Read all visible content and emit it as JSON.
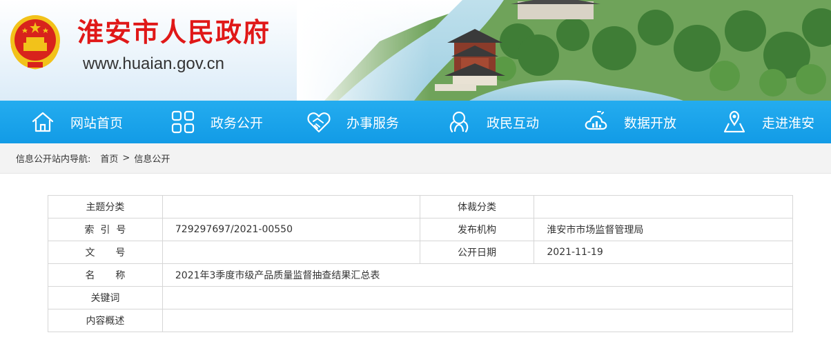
{
  "header": {
    "site_title": "淮安市人民政府",
    "site_url": "www.huaian.gov.cn",
    "brand_color": "#e01818"
  },
  "nav": {
    "items": [
      {
        "label": "网站首页",
        "icon": "home-icon"
      },
      {
        "label": "政务公开",
        "icon": "grid-icon"
      },
      {
        "label": "办事服务",
        "icon": "handshake-icon"
      },
      {
        "label": "政民互动",
        "icon": "interaction-icon"
      },
      {
        "label": "数据开放",
        "icon": "data-cloud-icon"
      },
      {
        "label": "走进淮安",
        "icon": "map-pin-icon"
      }
    ],
    "bg_color": "#1ba3ea"
  },
  "breadcrumb": {
    "label": "信息公开站内导航:",
    "items": [
      "首页",
      "信息公开"
    ],
    "separator": ">"
  },
  "info": {
    "rows": {
      "topic_label": "主题分类",
      "topic_value": "",
      "genre_label": "体裁分类",
      "genre_value": "",
      "index_label": "索引号",
      "index_value": "729297697/2021-00550",
      "publisher_label": "发布机构",
      "publisher_value": "淮安市市场监督管理局",
      "doc_no_label": "文号",
      "doc_no_value": "",
      "date_label": "公开日期",
      "date_value": "2021-11-19",
      "name_label": "名称",
      "name_value": "2021年3季度市级产品质量监督抽查结果汇总表",
      "keywords_label": "关键词",
      "keywords_value": "",
      "summary_label": "内容概述",
      "summary_value": ""
    }
  }
}
